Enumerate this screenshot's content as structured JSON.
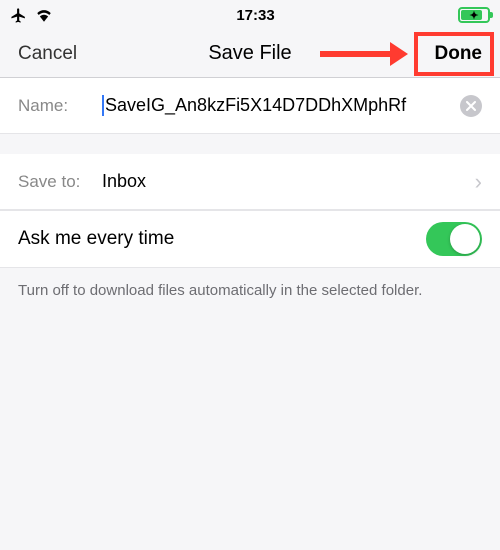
{
  "statusBar": {
    "time": "17:33"
  },
  "nav": {
    "cancel": "Cancel",
    "title": "Save File",
    "done": "Done"
  },
  "nameRow": {
    "label": "Name:",
    "value": "SaveIG_An8kzFi5X14D7DDhXMphRf"
  },
  "saveToRow": {
    "label": "Save to:",
    "value": "Inbox"
  },
  "toggleRow": {
    "label": "Ask me every time"
  },
  "footer": {
    "text": "Turn off to download files automatically in the selected folder."
  }
}
